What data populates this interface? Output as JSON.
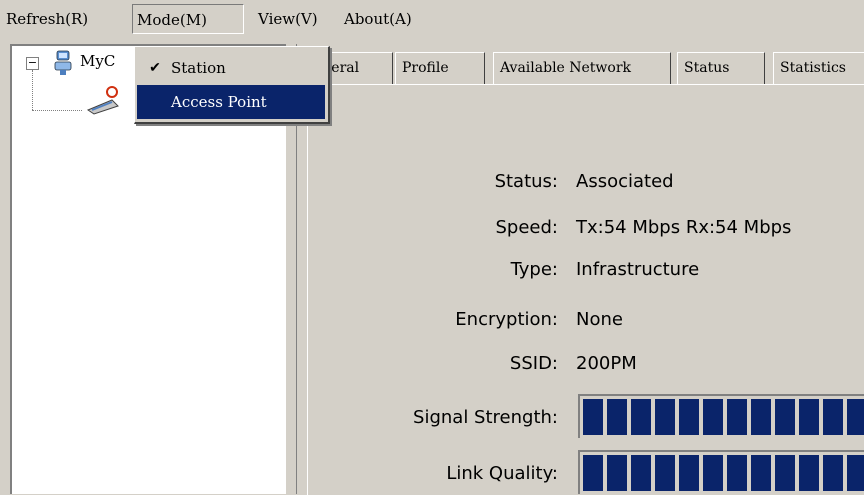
{
  "menubar": {
    "refresh": "Refresh(R)",
    "mode": "Mode(M)",
    "view": "View(V)",
    "about": "About(A)"
  },
  "mode_menu": {
    "station": "Station",
    "station_checked": true,
    "access_point": "Access Point"
  },
  "tree": {
    "root_label": "MyC",
    "root_icon": "computer-icon",
    "child_icon": "wireless-adapter-icon"
  },
  "tabs": {
    "general": "eneral",
    "profile": "Profile",
    "available_network": "Available Network",
    "status": "Status",
    "statistics": "Statistics"
  },
  "general": {
    "status_label": "Status:",
    "status_value": "Associated",
    "speed_label": "Speed:",
    "speed_value": "Tx:54 Mbps Rx:54 Mbps",
    "type_label": "Type:",
    "type_value": "Infrastructure",
    "encryption_label": "Encryption:",
    "encryption_value": "None",
    "ssid_label": "SSID:",
    "ssid_value": "200PM",
    "signal_label": "Signal Strength:",
    "signal_value": 1.0,
    "link_label": "Link Quality:",
    "link_value": 1.0
  },
  "colors": {
    "face": "#d4d0c8",
    "highlight": "#0a246a",
    "meter": "#0a246a"
  }
}
